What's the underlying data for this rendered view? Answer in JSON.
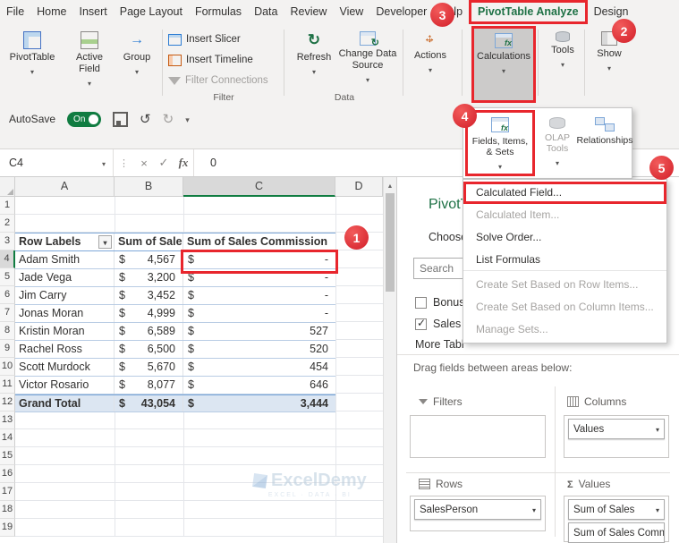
{
  "tabbar": {
    "tabs": [
      {
        "label": "File"
      },
      {
        "label": "Home"
      },
      {
        "label": "Insert"
      },
      {
        "label": "Page Layout"
      },
      {
        "label": "Formulas"
      },
      {
        "label": "Data"
      },
      {
        "label": "Review"
      },
      {
        "label": "View"
      },
      {
        "label": "Developer"
      },
      {
        "label": "Help"
      },
      {
        "label": "PivotTable Analyze",
        "active": true
      },
      {
        "label": "Design"
      }
    ]
  },
  "ribbon": {
    "buttons": {
      "pivottable": "PivotTable",
      "active_field": "Active Field",
      "group": "Group",
      "insert_slicer": "Insert Slicer",
      "insert_timeline": "Insert Timeline",
      "filter_connections": "Filter Connections",
      "refresh": "Refresh",
      "change_data_source": "Change Data Source",
      "actions": "Actions",
      "calculations": "Calculations",
      "tools": "Tools",
      "show": "Show"
    },
    "group_labels": {
      "filter": "Filter",
      "data": "Data"
    }
  },
  "qat": {
    "autosave_label": "AutoSave",
    "autosave_state": "On"
  },
  "formula_bar": {
    "name_box": "C4",
    "fx": "fx",
    "value": "0"
  },
  "calculations_menu": {
    "flyout": [
      {
        "label": "Fields, Items, & Sets",
        "highlighted": true
      },
      {
        "label": "OLAP Tools",
        "disabled": true
      },
      {
        "label": "Relationships"
      }
    ],
    "items": [
      {
        "label": "Calculated Field...",
        "highlighted": true
      },
      {
        "label": "Calculated Item...",
        "disabled": true
      },
      {
        "label": "Solve Order..."
      },
      {
        "label": "List Formulas",
        "group_end": true
      },
      {
        "label": "Create Set Based on Row Items...",
        "disabled": true
      },
      {
        "label": "Create Set Based on Column Items...",
        "disabled": true
      },
      {
        "label": "Manage Sets...",
        "disabled": true
      }
    ]
  },
  "sheet": {
    "column_headers": [
      "A",
      "B",
      "C",
      "D"
    ],
    "row_numbers": [
      1,
      2,
      3,
      4,
      5,
      6,
      7,
      8,
      9,
      10,
      11,
      12,
      13,
      14,
      15,
      16,
      17,
      18,
      19
    ],
    "currency": "$",
    "table": {
      "headers": [
        "Row Labels",
        "Sum of Sales",
        "Sum of Sales Commission"
      ],
      "rows": [
        {
          "name": "Adam Smith",
          "sales": "4,567",
          "commission": "-"
        },
        {
          "name": "Jade Vega",
          "sales": "3,200",
          "commission": "-"
        },
        {
          "name": "Jim Carry",
          "sales": "3,452",
          "commission": "-"
        },
        {
          "name": "Jonas Moran",
          "sales": "4,999",
          "commission": "-"
        },
        {
          "name": "Kristin Moran",
          "sales": "6,589",
          "commission": "527"
        },
        {
          "name": "Rachel Ross",
          "sales": "6,500",
          "commission": "520"
        },
        {
          "name": "Scott Murdock",
          "sales": "5,670",
          "commission": "454"
        },
        {
          "name": "Victor Rosario",
          "sales": "8,077",
          "commission": "646"
        }
      ],
      "grand_total": {
        "name": "Grand Total",
        "sales": "43,054",
        "commission": "3,444"
      }
    },
    "watermark": {
      "title": "ExcelDemy",
      "subtitle": "EXCEL · DATA · BI"
    }
  },
  "fields_pane": {
    "title": "PivotT",
    "choose_label": "Choose fie",
    "search_placeholder": "Search",
    "fields": [
      {
        "label": "Bonus"
      },
      {
        "label": "Sales C",
        "checked": true
      }
    ],
    "more_tables": "More Tabl",
    "drag_label": "Drag fields between areas below:",
    "areas": {
      "filters_label": "Filters",
      "columns_label": "Columns",
      "rows_label": "Rows",
      "values_label": "Values",
      "columns_items": [
        "Values"
      ],
      "rows_items": [
        "SalesPerson"
      ],
      "values_items": [
        "Sum of Sales",
        "Sum of Sales Comm..."
      ]
    }
  },
  "annotations": {
    "steps": [
      "1",
      "2",
      "3",
      "4",
      "5"
    ]
  }
}
